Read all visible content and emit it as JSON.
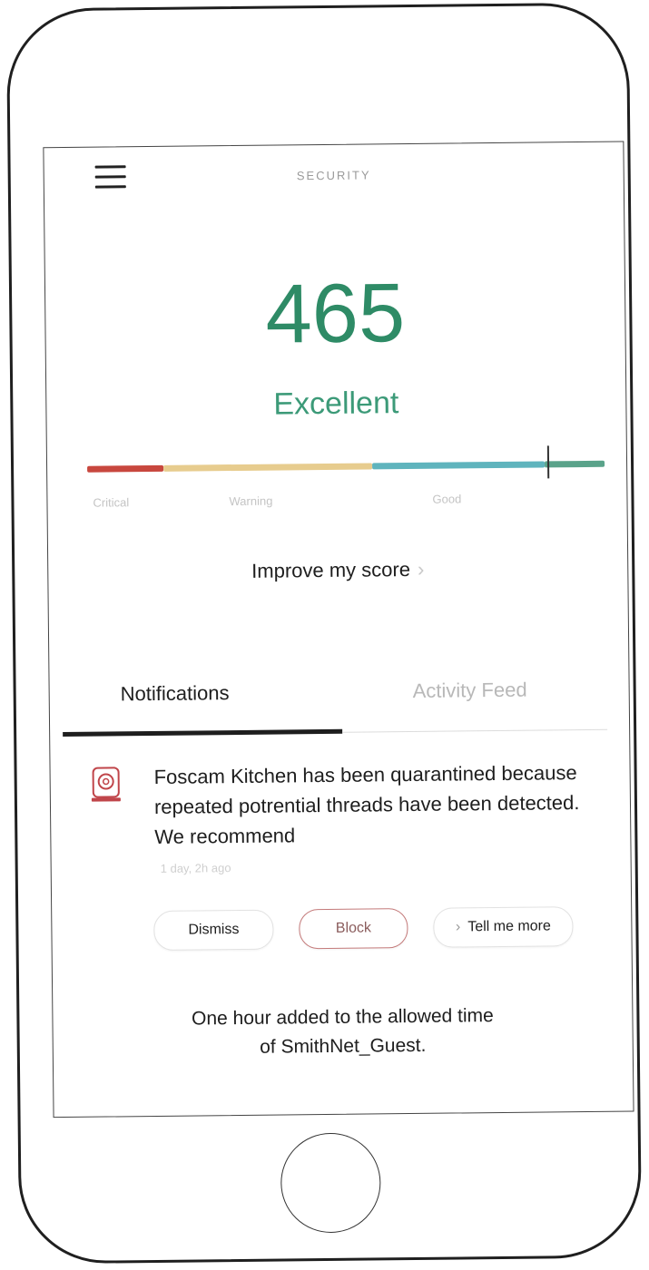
{
  "app": {
    "screen_title": "SECURITY"
  },
  "score": {
    "value": "465",
    "rating": "Excellent",
    "level": 0.89,
    "meter_labels": [
      "Critical",
      "Warning",
      "Good"
    ],
    "colors": {
      "critical": "#c8473e",
      "warning": "#e7cc8e",
      "good": "#5fb4bd",
      "excellent": "#5aa38a",
      "score_text": "#2e8b66"
    }
  },
  "improve_link": {
    "label": "Improve my score",
    "chevron": "›"
  },
  "tabs": [
    {
      "label": "Notifications",
      "active": true
    },
    {
      "label": "Activity Feed",
      "active": false
    }
  ],
  "notifications": [
    {
      "icon": "camera-icon",
      "message": "Foscam Kitchen has been quarantined because repeated potrential threads have been detected. We recommend",
      "time": "1 day, 2h ago",
      "actions": {
        "dismiss": "Dismiss",
        "block": "Block",
        "more_caret": "›",
        "more": "Tell me more"
      }
    },
    {
      "message_line1": "One hour added to the allowed time",
      "message_line2": "of SmithNet_Guest."
    }
  ]
}
